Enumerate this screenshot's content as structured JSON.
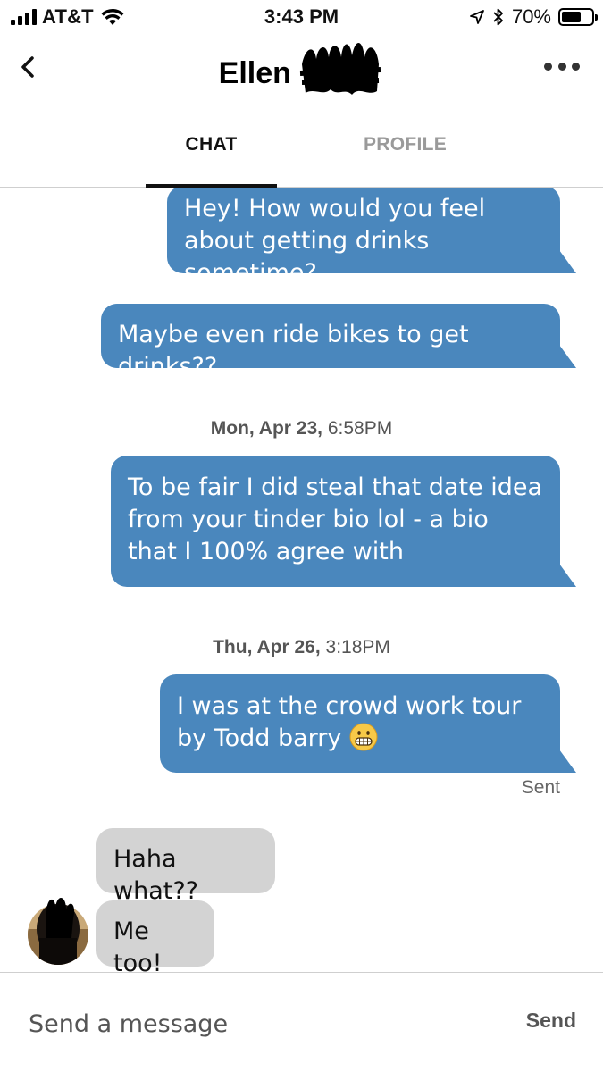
{
  "status_bar": {
    "carrier": "AT&T",
    "time": "3:43 PM",
    "battery_percent": "70%",
    "battery_level": 0.7,
    "icons": [
      "cellular-signal-icon",
      "wifi-icon",
      "location-arrow-icon",
      "bluetooth-icon",
      "battery-icon"
    ]
  },
  "header": {
    "title": "Ellen",
    "back_icon": "chevron-left-icon",
    "more_icon": "more-dots-icon"
  },
  "tabs": [
    {
      "label": "CHAT",
      "active": true
    },
    {
      "label": "PROFILE",
      "active": false
    }
  ],
  "messages": [
    {
      "direction": "out",
      "text": "Hey! How would you feel about getting drinks sometime?"
    },
    {
      "direction": "out",
      "text": "Maybe even ride bikes to get drinks??"
    },
    {
      "type": "timestamp",
      "day": "Mon, Apr 23,",
      "time": "6:58PM"
    },
    {
      "direction": "out",
      "text": "To be fair I did steal that date idea from your tinder bio lol - a bio that I 100% agree with"
    },
    {
      "type": "timestamp",
      "day": "Thu, Apr 26,",
      "time": "3:18PM"
    },
    {
      "direction": "out",
      "text": "I was at the crowd work tour by Todd barry",
      "emoji": "grimacing-face"
    },
    {
      "type": "status",
      "text": "Sent"
    },
    {
      "direction": "in",
      "text": "Haha what??"
    },
    {
      "direction": "in",
      "text": "Me too!"
    }
  ],
  "composer": {
    "placeholder": "Send a message",
    "send_label": "Send"
  },
  "colors": {
    "outgoing_bubble": "#4a87bd",
    "incoming_bubble": "#d3d3d3",
    "tab_inactive": "#9a9a9a"
  }
}
